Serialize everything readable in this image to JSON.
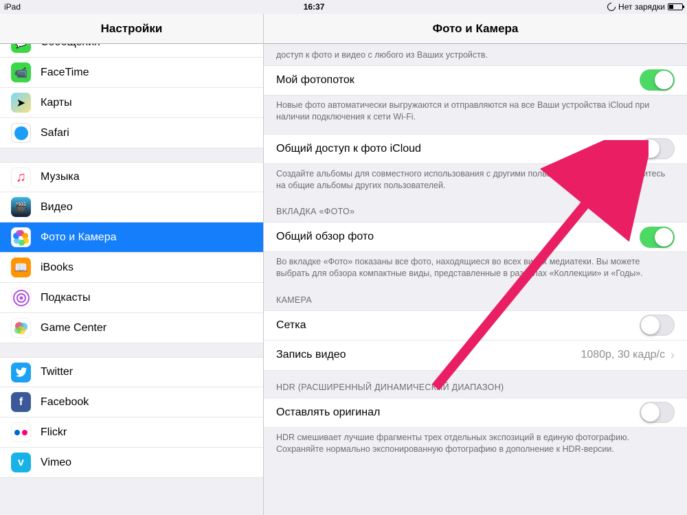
{
  "status": {
    "device": "iPad",
    "time": "16:37",
    "charging": "Нет зарядки"
  },
  "sidebar": {
    "title": "Настройки",
    "groups": [
      [
        {
          "id": "messages",
          "label": "Сообщения"
        },
        {
          "id": "facetime",
          "label": "FaceTime"
        },
        {
          "id": "maps",
          "label": "Карты"
        },
        {
          "id": "safari",
          "label": "Safari"
        }
      ],
      [
        {
          "id": "music",
          "label": "Музыка"
        },
        {
          "id": "video",
          "label": "Видео"
        },
        {
          "id": "photos",
          "label": "Фото и Камера",
          "selected": true
        },
        {
          "id": "ibooks",
          "label": "iBooks"
        },
        {
          "id": "podcasts",
          "label": "Подкасты"
        },
        {
          "id": "gamecenter",
          "label": "Game Center"
        }
      ],
      [
        {
          "id": "twitter",
          "label": "Twitter"
        },
        {
          "id": "facebook",
          "label": "Facebook"
        },
        {
          "id": "flickr",
          "label": "Flickr"
        },
        {
          "id": "vimeo",
          "label": "Vimeo"
        }
      ]
    ]
  },
  "content": {
    "title": "Фото и Камера",
    "truncated_footer": "доступ к фото и видео с любого из Ваших устройств.",
    "photostream": {
      "label": "Мой фотопоток",
      "on": true
    },
    "photostream_footer": "Новые фото автоматически выгружаются и отправляются на все Ваши устройства iCloud при наличии подключения к сети Wi-Fi.",
    "icloud_sharing": {
      "label": "Общий доступ к фото iCloud",
      "on": false
    },
    "icloud_sharing_footer": "Создайте альбомы для совместного использования с другими пользователями или подпишитесь на общие альбомы других пользователей.",
    "photos_tab_header": "ВКЛАДКА «ФОТО»",
    "summarize": {
      "label": "Общий обзор фото",
      "on": true
    },
    "summarize_footer": "Во вкладке «Фото» показаны все фото, находящиеся во всех видах медиатеки. Вы можете выбрать для обзора компактные виды, представленные в разделах «Коллекции» и «Годы».",
    "camera_header": "КАМЕРА",
    "grid": {
      "label": "Сетка",
      "on": false
    },
    "record_video": {
      "label": "Запись видео",
      "value": "1080p, 30 кадр/с"
    },
    "hdr_header": "HDR (РАСШИРЕННЫЙ ДИНАМИЧЕСКИЙ ДИАПАЗОН)",
    "keep_original": {
      "label": "Оставлять оригинал",
      "on": false
    },
    "hdr_footer": "HDR смешивает лучшие фрагменты трех отдельных экспозиций в единую фотографию. Сохраняйте нормально экспонированную фотографию в дополнение к HDR-версии."
  }
}
